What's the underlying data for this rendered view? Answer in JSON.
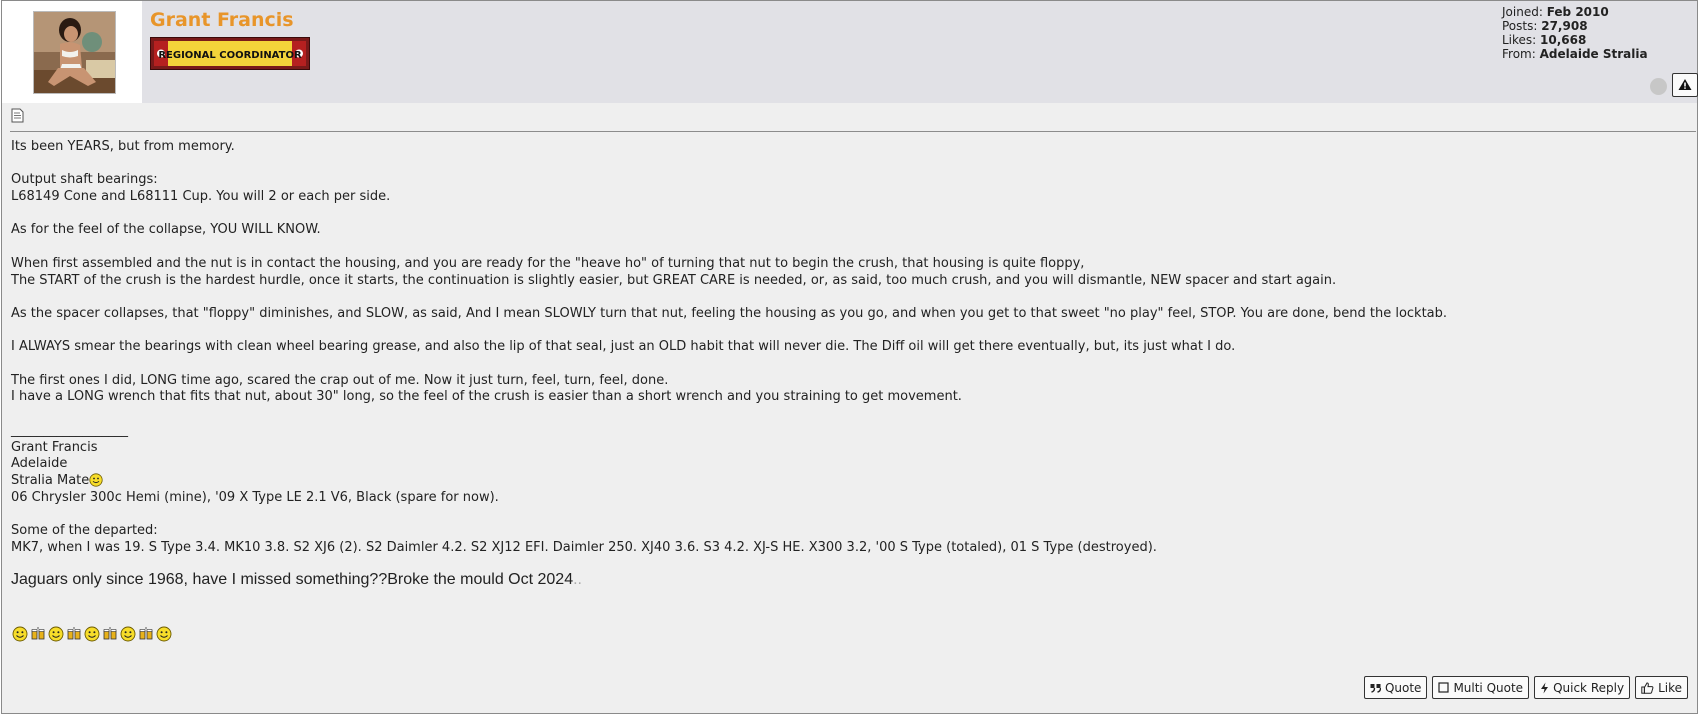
{
  "user": {
    "name": "Grant Francis",
    "rank": "REGIONAL COORDINATOR",
    "stats": [
      {
        "label": "Joined:",
        "value": "Feb 2010"
      },
      {
        "label": "Posts:",
        "value": "27,908"
      },
      {
        "label": "Likes:",
        "value": "10,668"
      },
      {
        "label": "From:",
        "value": "Adelaide Stralia"
      }
    ]
  },
  "colors": {
    "username": "#e8952a",
    "header_bg": "#e1e1e6",
    "post_bg": "#efefef",
    "rank_badge_bg": "#f4d33a"
  },
  "icons": {
    "post_icon": "document-icon",
    "online_status": "status-dot-icon",
    "report": "warning-icon"
  },
  "post": {
    "lines": [
      "Its been YEARS, but from memory.",
      "",
      "Output shaft bearings:",
      "L68149 Cone and L68111 Cup. You will 2 or each per side.",
      "",
      "As for the feel of the collapse, YOU WILL KNOW.",
      "",
      "When first assembled and the nut is in contact the housing, and you are ready for the \"heave ho\" of turning that nut to begin the crush, that housing is quite floppy,",
      "The START of the crush is the hardest hurdle, once it starts, the continuation is slightly easier, but GREAT CARE is needed, or, as said, too much crush, and you will dismantle, NEW spacer and start again.",
      "",
      "As the spacer collapses, that \"floppy\" diminishes, and SLOW, as said, And I mean SLOWLY turn that nut, feeling the housing as you go, and when you get to that sweet \"no play\" feel, STOP. You are done, bend the locktab.",
      "",
      "I ALWAYS smear the bearings with clean wheel bearing grease, and also the lip of that seal, just an OLD habit that will never die. The Diff oil will get there eventually, but, its just what I do.",
      "",
      "The first ones I did, LONG time ago, scared the crap out of me. Now it just turn, feel, turn, feel, done.",
      "I have a LONG wrench that fits that nut, about 30\" long, so the feel of the crush is easier than a short wrench and you straining to get movement."
    ]
  },
  "signature": {
    "separator": "__________________",
    "name": "Grant Francis",
    "city": "Adelaide",
    "stralia": "Stralia Mate",
    "cars": "06 Chrysler 300c Hemi (mine), '09 X Type LE 2.1 V6, Black (spare for now).",
    "departed_heading": "Some of the departed:",
    "departed_list": "MK7, when I was 19. S Type 3.4. MK10 3.8. S2 XJ6 (2). S2 Daimler 4.2. S2 XJ12 EFI. Daimler 250. XJ40 3.6. S3 4.2. XJ-S HE. X300 3.2, '00 S Type (totaled), 01 S Type (destroyed).",
    "tagline": "Jaguars only since 1968, have I missed something??Broke the mould Oct 2024",
    "tagline_dots": ".."
  },
  "actions": {
    "quote": "Quote",
    "multi_quote": "Multi Quote",
    "quick_reply": "Quick Reply",
    "like": "Like"
  }
}
